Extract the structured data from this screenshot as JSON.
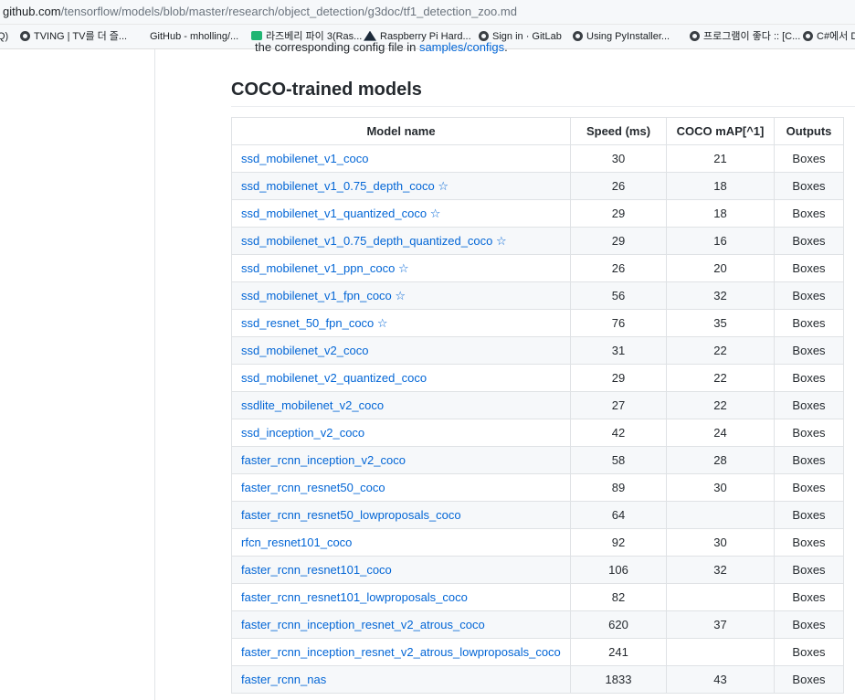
{
  "address_bar": {
    "host": "github.com",
    "path": "/tensorflow/models/blob/master/research/object_detection/g3doc/tf1_detection_zoo.md"
  },
  "bookmarks": [
    {
      "label": "Q)",
      "icon": "none"
    },
    {
      "label": "TVING | TV를 더 즐...",
      "icon": "globe-icon"
    },
    {
      "label": "GitHub - mholling/...",
      "icon": "none"
    },
    {
      "label": "라즈베리 파이 3(Ras...",
      "icon": "green-square-icon"
    },
    {
      "label": "Raspberry Pi Hard...",
      "icon": "raspberry-pi-icon"
    },
    {
      "label": "Sign in · GitLab",
      "icon": "globe-icon"
    },
    {
      "label": "Using PyInstaller...",
      "icon": "globe-icon"
    },
    {
      "label": "프로그램이 좋다 :: [C...",
      "icon": "globe-icon"
    },
    {
      "label": "C#에서 D",
      "icon": "globe-icon"
    }
  ],
  "content": {
    "cut_text_prefix": "the corresponding config file in ",
    "cut_text_link": "samples/configs",
    "cut_text_suffix": ".",
    "section_title": "COCO-trained models"
  },
  "table": {
    "headers": [
      "Model name",
      "Speed (ms)",
      "COCO mAP[^1]",
      "Outputs"
    ],
    "rows": [
      {
        "name": "ssd_mobilenet_v1_coco",
        "speed": "30",
        "map": "21",
        "outputs": "Boxes"
      },
      {
        "name": "ssd_mobilenet_v1_0.75_depth_coco ☆",
        "speed": "26",
        "map": "18",
        "outputs": "Boxes"
      },
      {
        "name": "ssd_mobilenet_v1_quantized_coco ☆",
        "speed": "29",
        "map": "18",
        "outputs": "Boxes"
      },
      {
        "name": "ssd_mobilenet_v1_0.75_depth_quantized_coco ☆",
        "speed": "29",
        "map": "16",
        "outputs": "Boxes"
      },
      {
        "name": "ssd_mobilenet_v1_ppn_coco ☆",
        "speed": "26",
        "map": "20",
        "outputs": "Boxes"
      },
      {
        "name": "ssd_mobilenet_v1_fpn_coco ☆",
        "speed": "56",
        "map": "32",
        "outputs": "Boxes"
      },
      {
        "name": "ssd_resnet_50_fpn_coco ☆",
        "speed": "76",
        "map": "35",
        "outputs": "Boxes"
      },
      {
        "name": "ssd_mobilenet_v2_coco",
        "speed": "31",
        "map": "22",
        "outputs": "Boxes"
      },
      {
        "name": "ssd_mobilenet_v2_quantized_coco",
        "speed": "29",
        "map": "22",
        "outputs": "Boxes"
      },
      {
        "name": "ssdlite_mobilenet_v2_coco",
        "speed": "27",
        "map": "22",
        "outputs": "Boxes"
      },
      {
        "name": "ssd_inception_v2_coco",
        "speed": "42",
        "map": "24",
        "outputs": "Boxes"
      },
      {
        "name": "faster_rcnn_inception_v2_coco",
        "speed": "58",
        "map": "28",
        "outputs": "Boxes"
      },
      {
        "name": "faster_rcnn_resnet50_coco",
        "speed": "89",
        "map": "30",
        "outputs": "Boxes"
      },
      {
        "name": "faster_rcnn_resnet50_lowproposals_coco",
        "speed": "64",
        "map": "",
        "outputs": "Boxes"
      },
      {
        "name": "rfcn_resnet101_coco",
        "speed": "92",
        "map": "30",
        "outputs": "Boxes"
      },
      {
        "name": "faster_rcnn_resnet101_coco",
        "speed": "106",
        "map": "32",
        "outputs": "Boxes"
      },
      {
        "name": "faster_rcnn_resnet101_lowproposals_coco",
        "speed": "82",
        "map": "",
        "outputs": "Boxes"
      },
      {
        "name": "faster_rcnn_inception_resnet_v2_atrous_coco",
        "speed": "620",
        "map": "37",
        "outputs": "Boxes"
      },
      {
        "name": "faster_rcnn_inception_resnet_v2_atrous_lowproposals_coco",
        "speed": "241",
        "map": "",
        "outputs": "Boxes"
      },
      {
        "name": "faster_rcnn_nas",
        "speed": "1833",
        "map": "43",
        "outputs": "Boxes"
      }
    ]
  }
}
